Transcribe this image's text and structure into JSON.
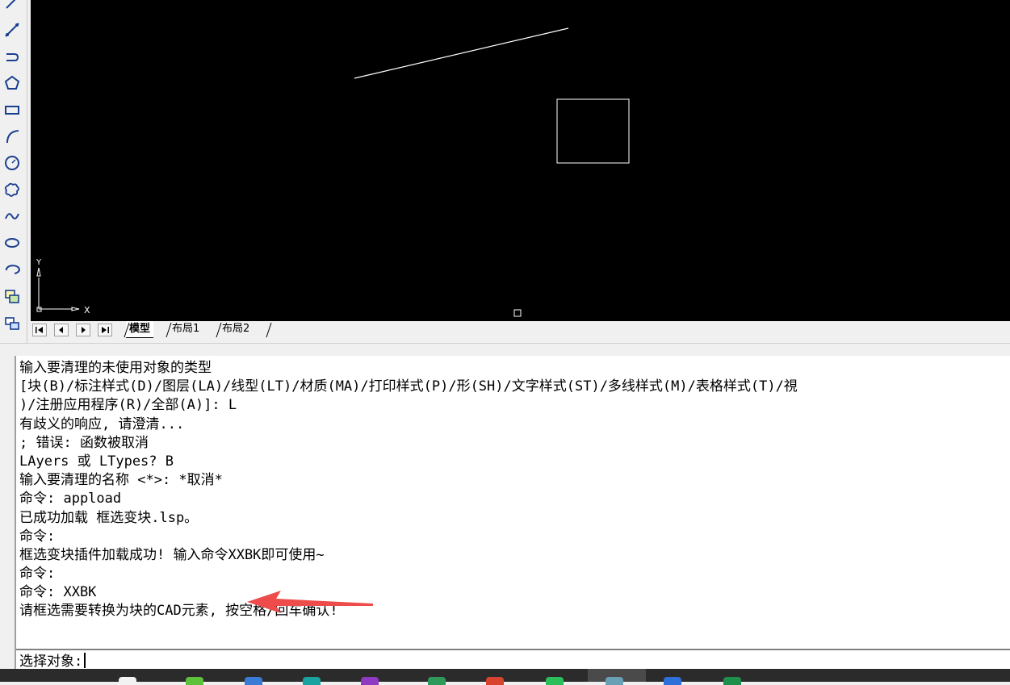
{
  "toolbar": {
    "icons": [
      "line-icon",
      "construction-line-icon",
      "polyline-icon",
      "polygon-icon",
      "rectangle-icon",
      "arc-icon",
      "circle-icon",
      "revision-cloud-icon",
      "spline-icon",
      "ellipse-icon",
      "ellipse-arc-icon",
      "insert-block-icon",
      "make-block-icon"
    ]
  },
  "ucs": {
    "y_label": "Y",
    "x_label": "X"
  },
  "tabs": [
    "模型",
    "布局1",
    "布局2"
  ],
  "command_history": [
    "输入要清理的未使用对象的类型",
    "[块(B)/标注样式(D)/图层(LA)/线型(LT)/材质(MA)/打印样式(P)/形(SH)/文字样式(ST)/多线样式(M)/表格样式(T)/視",
    ")/注册应用程序(R)/全部(A)]: L",
    "有歧义的响应, 请澄清...",
    "; 错误: 函数被取消",
    "LAyers 或 LTypes? B",
    "输入要清理的名称 <*>: *取消*",
    "命令: appload",
    "已成功加载 框选变块.lsp。",
    "命令:",
    "框选变块插件加载成功! 输入命令XXBK即可使用~",
    "命令:",
    "命令: XXBK",
    "请框选需要转换为块的CAD元素, 按空格/回车确认!"
  ],
  "command_prompt": "选择对象:",
  "colors": {
    "canvas": "#000000",
    "drawing_stroke": "#ffffff",
    "annotation_arrow": "#ee4b4b"
  },
  "taskbar_icons": [
    "browser-icon",
    "360-browser-icon",
    "blue-app-icon",
    "teal-app-icon",
    "purple-app-icon",
    "green-app-icon",
    "red-app-icon",
    "wechat-icon",
    "cad-app-icon",
    "blue-doc-icon",
    "excel-icon"
  ]
}
